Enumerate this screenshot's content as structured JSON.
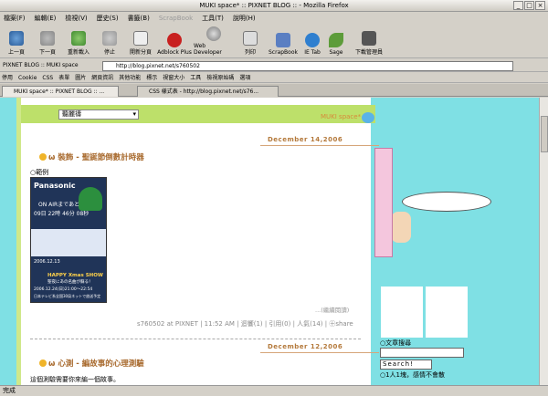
{
  "window": {
    "title": "MUKI space* :: PIXNET BLOG :: - Mozilla Firefox"
  },
  "menubar": [
    "檔案(F)",
    "編輯(E)",
    "檢視(V)",
    "歷史(S)",
    "書籤(B)",
    "ScrapBook",
    "工具(T)",
    "說明(H)"
  ],
  "toolbar": [
    {
      "label": "上一頁",
      "icon": "back-icon"
    },
    {
      "label": "下一頁",
      "icon": "forward-icon"
    },
    {
      "label": "重新載入",
      "icon": "reload-icon"
    },
    {
      "label": "停止",
      "icon": "stop-icon"
    },
    {
      "label": "開新分頁",
      "icon": "new-tab-icon"
    },
    {
      "label": "Adblock Plus",
      "icon": "adblock-icon"
    },
    {
      "label": "Web Developer",
      "icon": "gear-icon"
    },
    {
      "label": "列印",
      "icon": "print-icon"
    },
    {
      "label": "ScrapBook",
      "icon": "scrapbook-icon"
    },
    {
      "label": "IE Tab",
      "icon": "ie-icon"
    },
    {
      "label": "Sage",
      "icon": "sage-icon"
    },
    {
      "label": "下載管理員",
      "icon": "download-icon"
    }
  ],
  "urlbar": {
    "page_label": "PIXNET BLOG :: MUKI space",
    "url": "http://blog.pixnet.net/s760502"
  },
  "bookmarks": [
    "停用",
    "Cookie",
    "CSS",
    "表單",
    "圖片",
    "網頁資訊",
    "其他功能",
    "標示",
    "視窗大小",
    "工具",
    "檢視原始碼",
    "選項"
  ],
  "tabs": [
    {
      "label": "MUKI space* :: PIXNET BLOG :: ..."
    },
    {
      "label": "CSS 樣式表 - http://blog.pixnet.net/s76..."
    }
  ],
  "blog": {
    "name": "MUKI space*",
    "category_select": "聽麗禱",
    "posts": [
      {
        "date": "December 14,2006",
        "title": "ω 裝飾 - 聖誕節倒數計時器",
        "sub": "○範例",
        "read_more": "...(繼續閱讀)",
        "footer": "s760502 at PIXNET | 11:52 AM | 迴響(1) | 引用(0) | 人氣(14) | ㊉share"
      },
      {
        "date": "December 12,2006",
        "title": "ω 心測 - 編故事的心理測驗",
        "excerpt": "這個測驗需要你來編一個故事。"
      }
    ],
    "widget": {
      "brand": "Panasonic",
      "on_air": "ON AIRまであと",
      "countdown": "09日 22時 46分 08秒",
      "date": "2006.12.13",
      "show_name": "HAPPY Xmas SHOW",
      "show_sub": "聖夜にあの名曲が蘇る！",
      "air_time": "2006.12.24(日)21:00〜22:54",
      "network": "日本テレビ系全国30局ネットで放送予定"
    }
  },
  "sidebar": {
    "search_label": "○文章搜尋",
    "search_button": "Search!",
    "online": "○1人1塊，感情不會散"
  },
  "status": {
    "text": "完成"
  }
}
